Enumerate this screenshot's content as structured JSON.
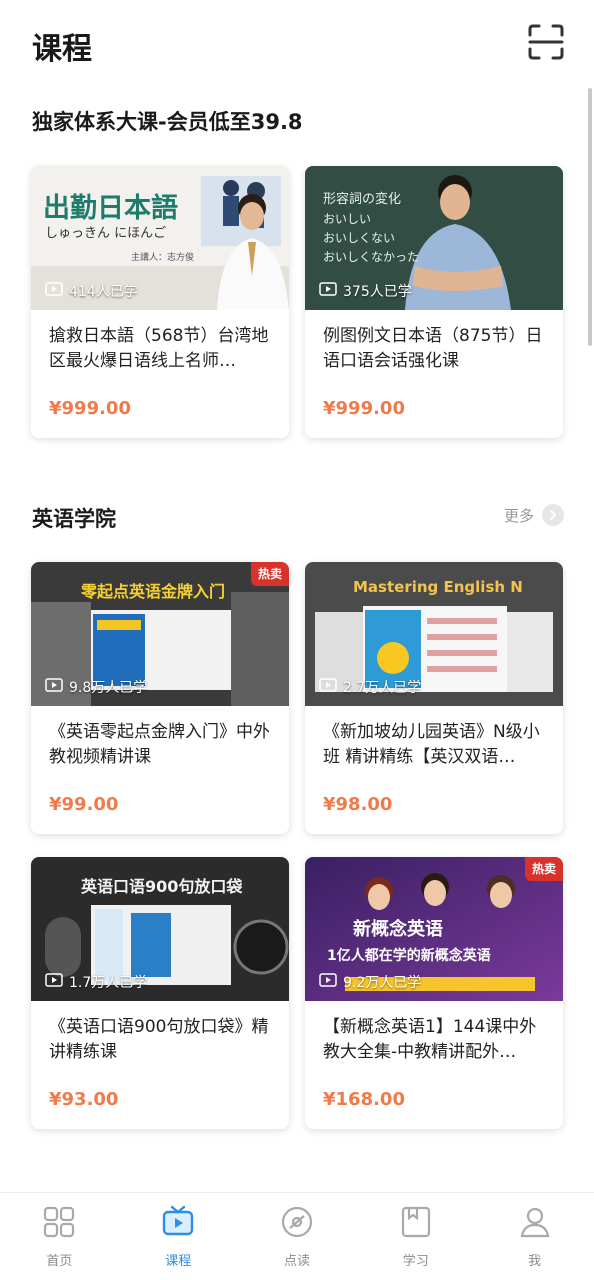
{
  "header": {
    "title": "课程",
    "scan_icon": "scan-icon"
  },
  "section1": {
    "title": "独家体系大课-会员低至39.8",
    "cards": [
      {
        "thumb_text": "出勤日本語",
        "thumb_sub": "しゅっきん にほんご",
        "thumb_lecturer": "主講人：志方俊",
        "count": "414人已学",
        "title": "搶救日本語（568节）台湾地区最火爆日语线上名师…",
        "price": "¥999.00"
      },
      {
        "thumb_text": "形容詞の変化",
        "thumb_lines": [
          "おいしい",
          "おいしくない",
          "おいしくなかった"
        ],
        "count": "375人已学",
        "title": "例图例文日本语（875节）日语口语会话强化课",
        "price": "¥999.00"
      }
    ]
  },
  "section2": {
    "title": "英语学院",
    "more_label": "更多",
    "cards": [
      {
        "badge": "热卖",
        "thumb_text": "零起点英语金牌入门",
        "count": "9.8万人已学",
        "title": "《英语零起点金牌入门》中外教视频精讲课",
        "price": "¥99.00"
      },
      {
        "badge": "",
        "thumb_text": "Mastering English N",
        "count": "2.7万人已学",
        "title": "《新加坡幼儿园英语》N级小班 精讲精练【英汉双语…",
        "price": "¥98.00"
      },
      {
        "badge": "",
        "thumb_text": "英语口语900句放口袋",
        "count": "1.7万人已学",
        "title": "《英语口语900句放口袋》精讲精练课",
        "price": "¥93.00"
      },
      {
        "badge": "热卖",
        "thumb_text": "新概念英语",
        "thumb_sub": "1亿人都在学的新概念英语",
        "count": "9.2万人已学",
        "title": "【新概念英语1】144课中外教大全集-中教精讲配外…",
        "price": "¥168.00"
      }
    ]
  },
  "tabbar": {
    "active": "课程",
    "items": [
      {
        "label": "首页",
        "icon": "home-grid-icon"
      },
      {
        "label": "课程",
        "icon": "course-tv-icon"
      },
      {
        "label": "点读",
        "icon": "read-disc-icon"
      },
      {
        "label": "学习",
        "icon": "study-book-icon"
      },
      {
        "label": "我",
        "icon": "profile-icon"
      }
    ]
  },
  "colors": {
    "price": "#ef7b4b",
    "active_tab": "#2f8ee0",
    "hot_badge": "#d9312b"
  }
}
